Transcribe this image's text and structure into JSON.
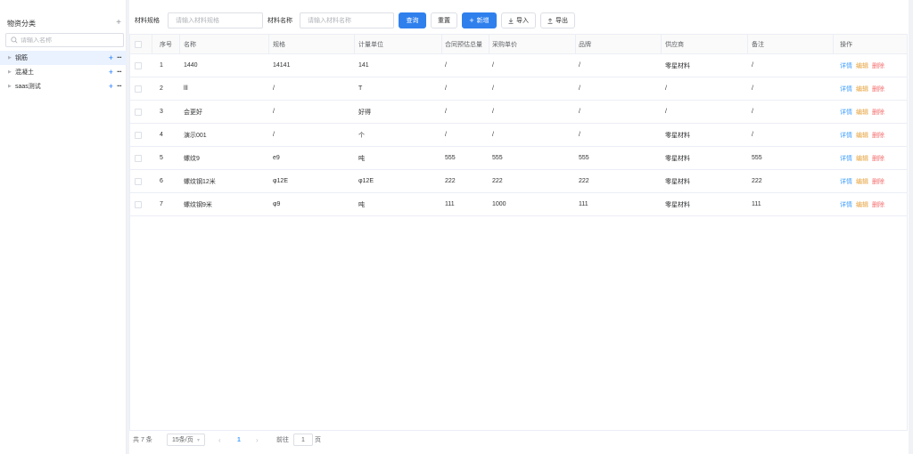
{
  "sidebar": {
    "title": "物资分类",
    "search_placeholder": "请输入名称",
    "items": [
      {
        "label": "钢筋"
      },
      {
        "label": "混凝土"
      },
      {
        "label": "saas测试"
      }
    ]
  },
  "toolbar": {
    "spec_label": "材料规格",
    "spec_placeholder": "请输入材料规格",
    "name_label": "材料名称",
    "name_placeholder": "请输入材料名称",
    "query_label": "查询",
    "reset_label": "重置",
    "add_label": "新增",
    "import_label": "导入",
    "export_label": "导出"
  },
  "table": {
    "columns": [
      "序号",
      "名称",
      "规格",
      "计量单位",
      "合同预估总量",
      "采购单价",
      "品牌",
      "供应商",
      "备注",
      "操作"
    ],
    "rows": [
      [
        "1",
        "1440",
        "14141",
        "141",
        "/",
        "/",
        "/",
        "零星材料",
        "/"
      ],
      [
        "2",
        "lll",
        "/",
        "T",
        "/",
        "/",
        "/",
        "/",
        "/"
      ],
      [
        "3",
        "会更好",
        "/",
        "好得",
        "/",
        "/",
        "/",
        "/",
        "/"
      ],
      [
        "4",
        "演示001",
        "/",
        "个",
        "/",
        "/",
        "/",
        "零星材料",
        "/"
      ],
      [
        "5",
        "螺纹9",
        "e9",
        "吨",
        "555",
        "555",
        "555",
        "零星材料",
        "555"
      ],
      [
        "6",
        "螺纹钢12米",
        "φ12E",
        "φ12E",
        "222",
        "222",
        "222",
        "零星材料",
        "222"
      ],
      [
        "7",
        "螺纹钢9米",
        "φ9",
        "吨",
        "111",
        "1000",
        "111",
        "零星材料",
        "111"
      ]
    ],
    "actions": {
      "detail": "详情",
      "edit": "编辑",
      "delete": "删除"
    }
  },
  "pagination": {
    "total": "共 7 条",
    "page_size": "15条/页",
    "current_page": "1",
    "goto_label": "前往",
    "goto_value": "1",
    "page_suffix": "页"
  },
  "colors": {
    "primary": "#2f80ed",
    "detail": "#409eff",
    "edit": "#e6a23c",
    "delete": "#f56c6c"
  }
}
